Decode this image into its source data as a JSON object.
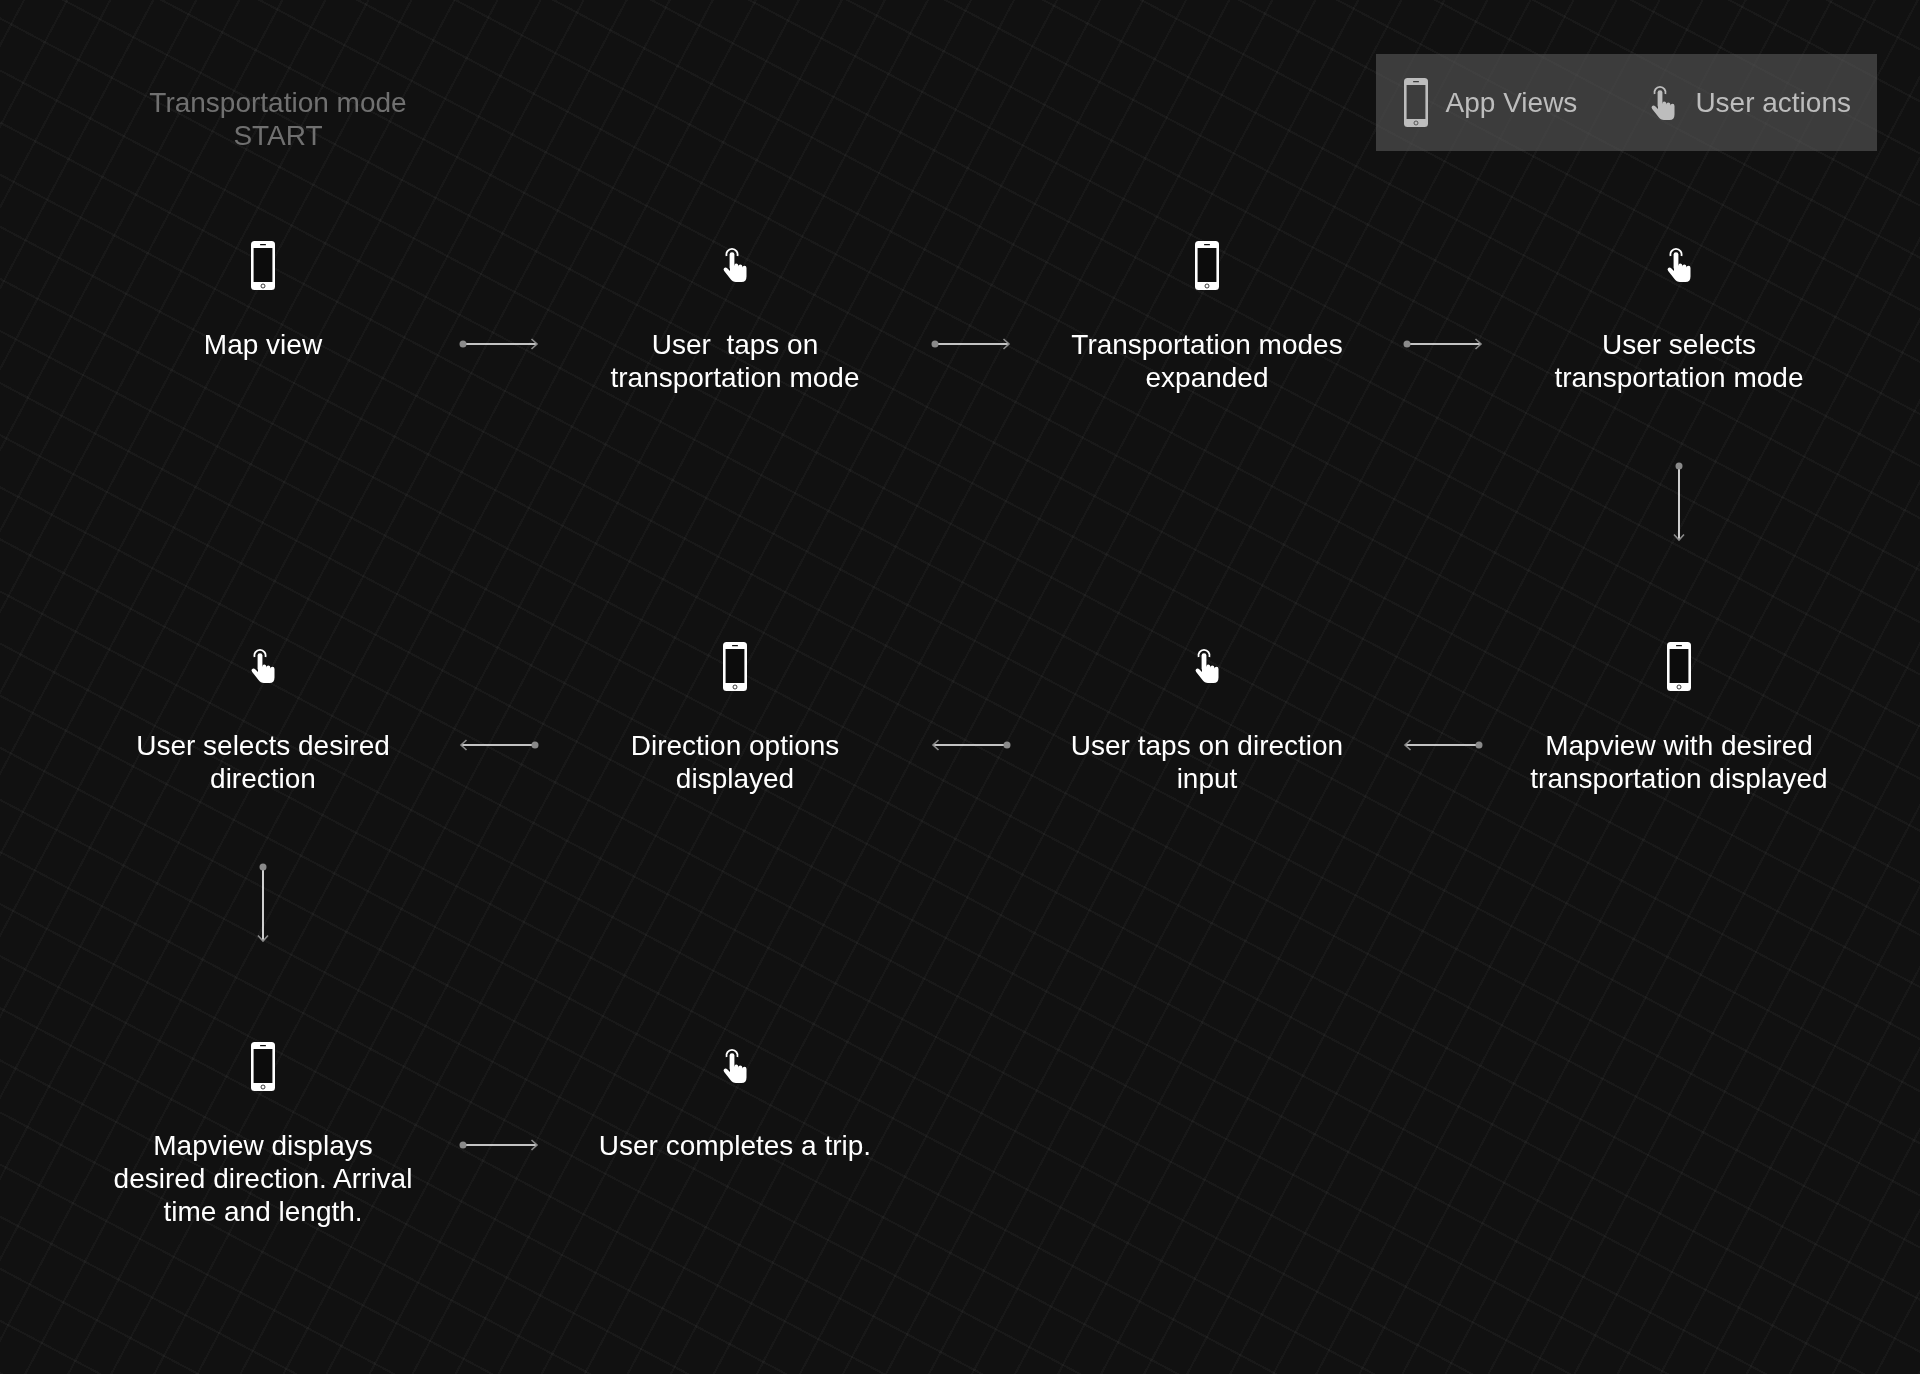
{
  "title": "Transportation mode\nSTART",
  "legend": {
    "items": [
      {
        "kind": "app_view",
        "label": "App Views"
      },
      {
        "kind": "user_action",
        "label": "User actions"
      }
    ]
  },
  "steps": [
    {
      "kind": "app_view",
      "label": "Map view",
      "connector": {
        "kind": "right"
      }
    },
    {
      "kind": "user_action",
      "label": "User  taps on\ntransportation mode",
      "connector": {
        "kind": "right"
      }
    },
    {
      "kind": "app_view",
      "label": "Transportation modes\nexpanded",
      "connector": {
        "kind": "right"
      }
    },
    {
      "kind": "user_action",
      "label": "User selects\ntransportation mode",
      "connector": {
        "kind": "down"
      }
    },
    {
      "kind": "user_action",
      "label": "User selects desired\ndirection",
      "connector": {
        "kind": "down"
      }
    },
    {
      "kind": "app_view",
      "label": "Direction options\ndisplayed",
      "connector": {
        "kind": "left"
      }
    },
    {
      "kind": "user_action",
      "label": "User taps on direction\ninput",
      "connector": {
        "kind": "left"
      }
    },
    {
      "kind": "app_view",
      "label": "Mapview with desired\ntransportation displayed",
      "connector": {
        "kind": "left"
      }
    },
    {
      "kind": "app_view",
      "label": "Mapview displays\ndesired direction. Arrival\ntime and length.",
      "connector": {
        "kind": "right"
      }
    },
    {
      "kind": "user_action",
      "label": "User completes a trip."
    }
  ]
}
